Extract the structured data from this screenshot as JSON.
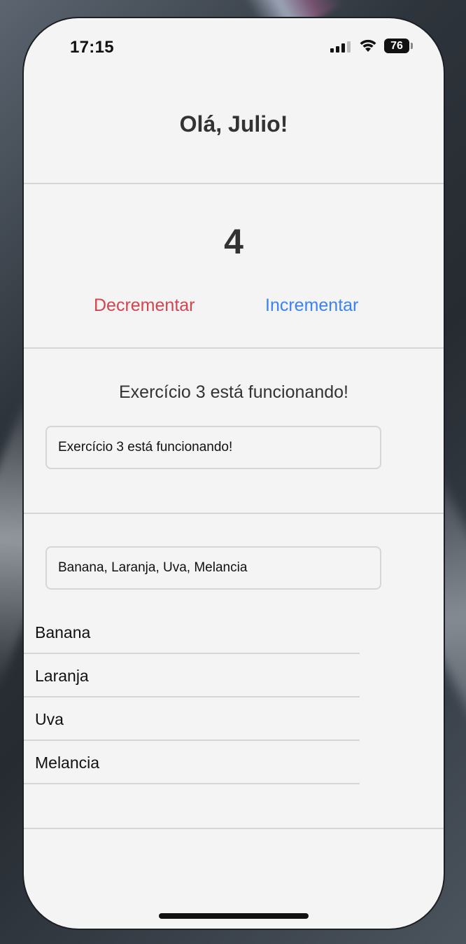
{
  "status_bar": {
    "time": "17:15",
    "battery": "76"
  },
  "greeting": "Olá, Julio!",
  "counter": {
    "value": "4",
    "decrement_label": "Decrementar",
    "increment_label": "Incrementar"
  },
  "exercise3": {
    "display_text": "Exercício 3 está funcionando!",
    "input_value": "Exercício 3 está funcionando!"
  },
  "fruits": {
    "input_value": "Banana, Laranja, Uva, Melancia",
    "items": [
      "Banana",
      "Laranja",
      "Uva",
      "Melancia"
    ]
  },
  "colors": {
    "background": "#f4f4f4",
    "decrement": "#d4444f",
    "increment": "#3b82f6",
    "divider": "#d6d6d6"
  }
}
